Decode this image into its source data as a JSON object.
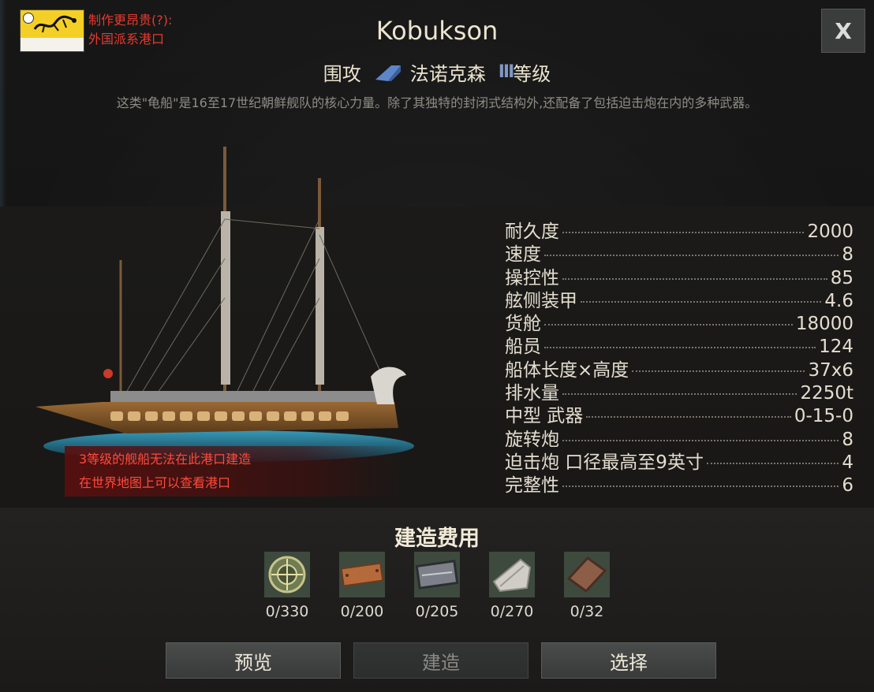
{
  "port_note": {
    "line1": "制作更昂贵(?):",
    "line2": "外国派系港口"
  },
  "close_label": "X",
  "ship": {
    "name": "Kobukson",
    "role": "围攻",
    "class_name": "法诺克森",
    "rank_icon": "III",
    "rank_label": "等级",
    "description": "这类\"龟船\"是16至17世纪朝鲜舰队的核心力量。除了其独特的封闭式结构外,还配备了包括迫击炮在内的多种武器。"
  },
  "warning": {
    "line1": "3等级的舰船无法在此港口建造",
    "line2": "在世界地图上可以查看港口"
  },
  "stats": [
    {
      "label": "耐久度",
      "value": "2000"
    },
    {
      "label": "速度",
      "value": "8"
    },
    {
      "label": "操控性",
      "value": "85"
    },
    {
      "label": "舷侧装甲",
      "value": "4.6"
    },
    {
      "label": "货舱",
      "value": "18000"
    },
    {
      "label": "船员",
      "value": "124"
    },
    {
      "label": "船体长度×高度",
      "value": "37x6"
    },
    {
      "label": "排水量",
      "value": "2250t"
    },
    {
      "label": "中型 武器",
      "value": "0-15-0"
    },
    {
      "label": "旋转炮",
      "value": "8"
    },
    {
      "label": "迫击炮 口径最高至9英寸",
      "value": "4"
    },
    {
      "label": "完整性",
      "value": "6"
    }
  ],
  "cost": {
    "title": "建造费用",
    "resources": [
      {
        "icon": "compass-icon",
        "amount": "0/330"
      },
      {
        "icon": "copper-plate-icon",
        "amount": "0/200"
      },
      {
        "icon": "riveted-iron-plate-icon",
        "amount": "0/205"
      },
      {
        "icon": "sailcloth-icon",
        "amount": "0/270"
      },
      {
        "icon": "bronze-plate-icon",
        "amount": "0/32"
      }
    ]
  },
  "buttons": {
    "preview": "预览",
    "build": "建造",
    "select": "选择"
  }
}
